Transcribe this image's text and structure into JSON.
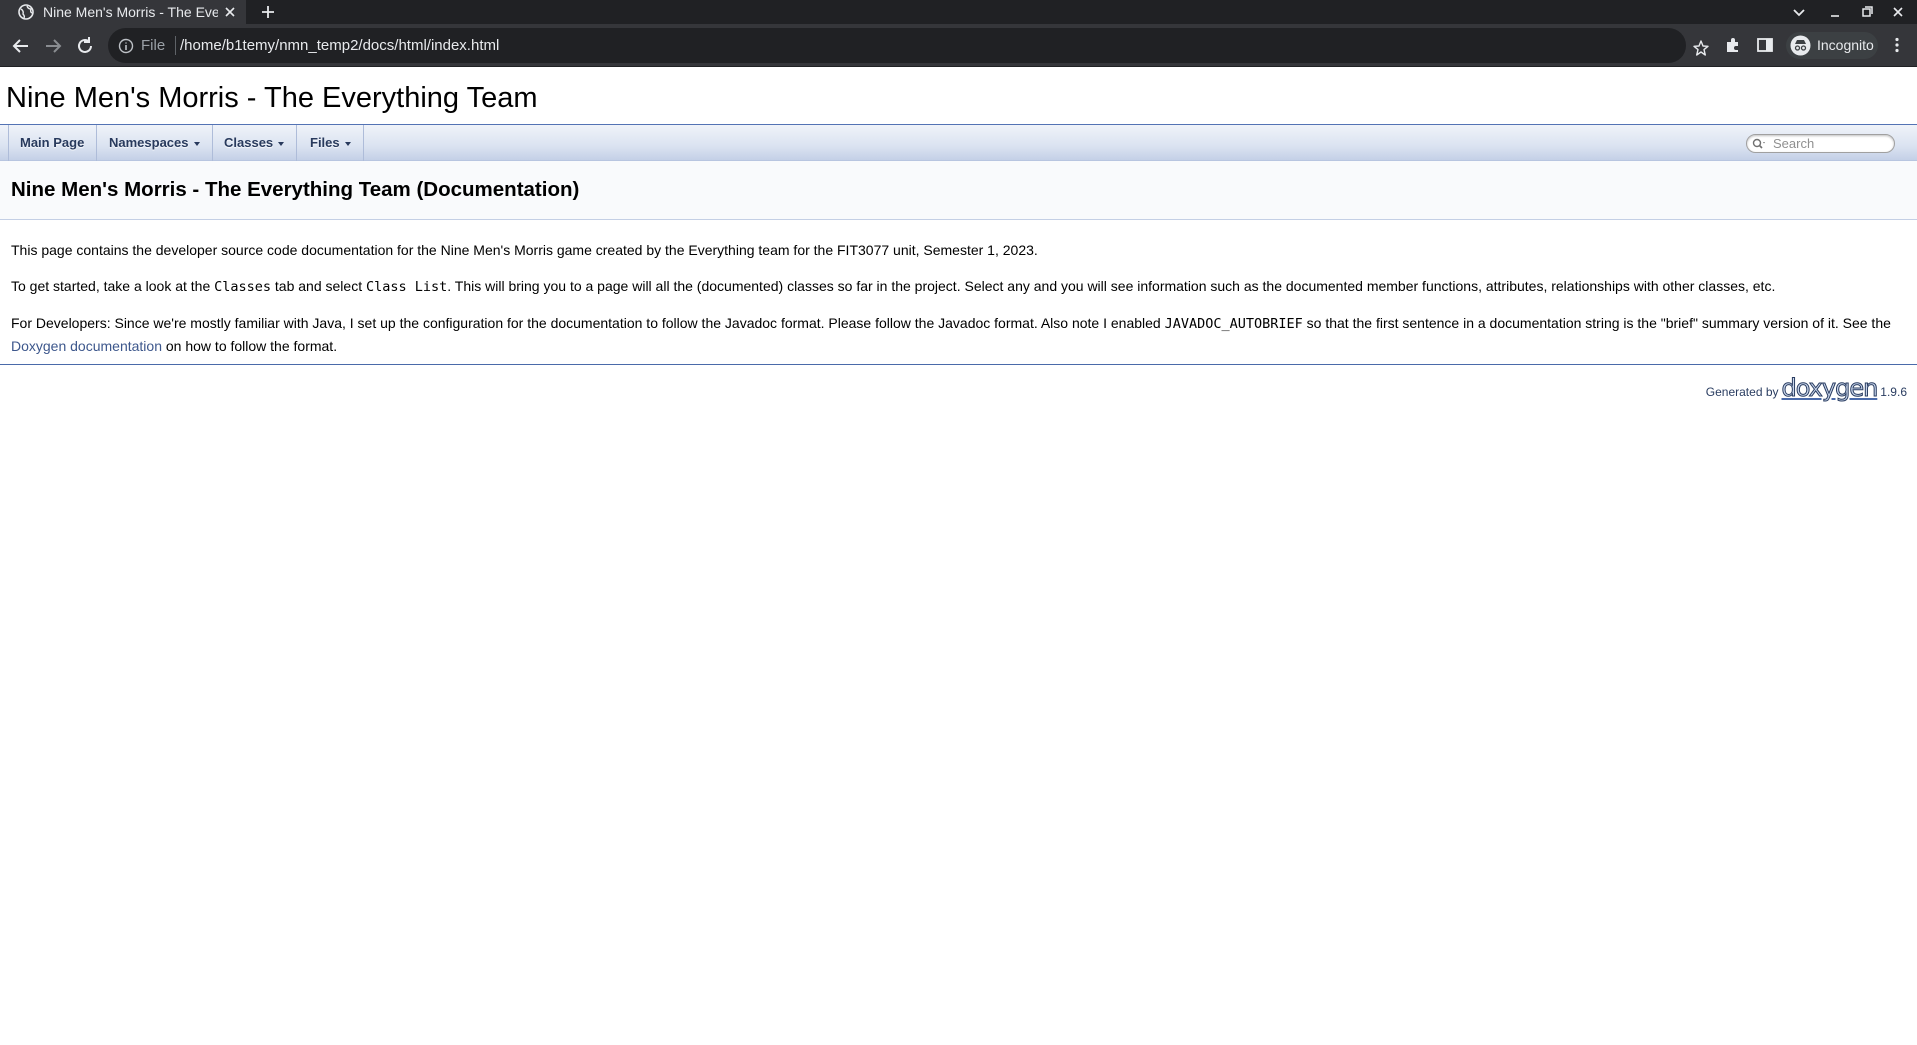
{
  "browser": {
    "tab_title": "Nine Men's Morris - The Everything Team",
    "omnibox_scheme": "File",
    "url": "/home/b1temy/nmn_temp2/docs/html/index.html",
    "profile_label": "Incognito"
  },
  "doc": {
    "project_name": "Nine Men's Morris - The Everything Team",
    "nav": {
      "main_page": "Main Page",
      "namespaces": "Namespaces",
      "classes": "Classes",
      "files": "Files"
    },
    "search_placeholder": "Search",
    "page_title": "Nine Men's Morris - The Everything Team (Documentation)",
    "para1": "This page contains the developer source code documentation for the Nine Men's Morris game created by the Everything team for the FIT3077 unit, Semester 1, 2023.",
    "para2": {
      "t1": "To get started, take a look at the ",
      "code1": "Classes",
      "t2": " tab and select ",
      "code2": "Class List",
      "t3": ". This will bring you to a page will all the (documented) classes so far in the project. Select any and you will see information such as the documented member functions, attributes, relationships with other classes, etc."
    },
    "para3": {
      "t1": "For Developers: Since we're mostly familiar with Java, I set up the configuration for the documentation to follow the Javadoc format. Please follow the Javadoc format. Also note I enabled ",
      "code1": "JAVADOC_AUTOBRIEF",
      "t2": " so that the first sentence in a documentation string is the \"brief\" summary version of it. See the ",
      "link": "Doxygen documentation",
      "t3": " on how to follow the format."
    },
    "footer": {
      "generated_by": "Generated by",
      "logo_text": "doxygen",
      "version": "1.9.6"
    }
  },
  "colors": {
    "chrome_dark": "#202124",
    "chrome_tab": "#35363a",
    "link": "#3d578c",
    "nav_text": "#283a5d",
    "rule": "#4a6aaa"
  }
}
